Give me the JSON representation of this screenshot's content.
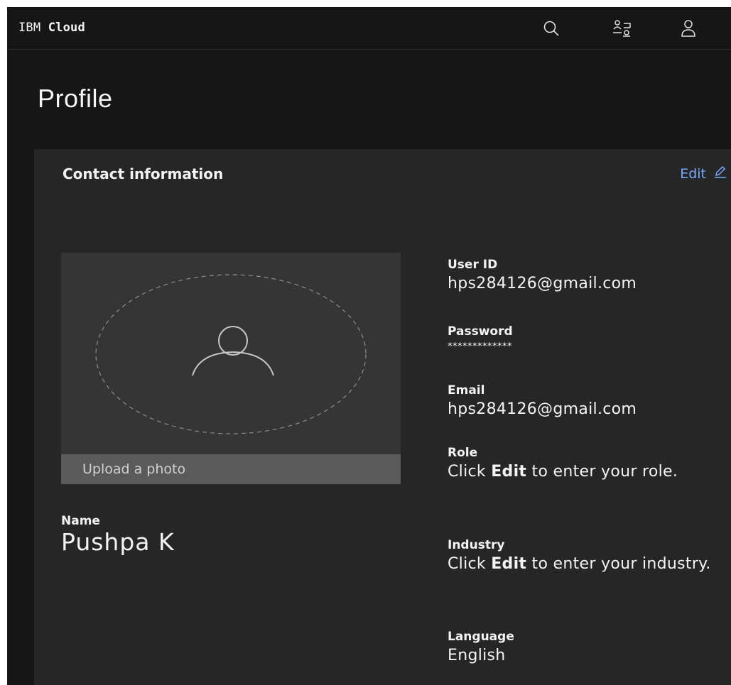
{
  "header": {
    "brand_prefix": "IBM",
    "brand_name": "Cloud",
    "icons": [
      "search-icon",
      "switcher-icon",
      "user-icon"
    ]
  },
  "page": {
    "title": "Profile"
  },
  "card": {
    "title": "Contact information",
    "edit_label": "Edit",
    "edit_icon": "pencil-icon"
  },
  "photo": {
    "upload_label": "Upload a photo"
  },
  "name": {
    "label": "Name",
    "value": "Pushpa K"
  },
  "fields": {
    "user_id": {
      "label": "User ID",
      "value": "hps284126@gmail.com"
    },
    "password": {
      "label": "Password",
      "value": "*************"
    },
    "email": {
      "label": "Email",
      "value": "hps284126@gmail.com"
    },
    "role": {
      "label": "Role",
      "prefix": "Click ",
      "emphasis": "Edit",
      "suffix": " to enter your role."
    },
    "industry": {
      "label": "Industry",
      "prefix": "Click ",
      "emphasis": "Edit",
      "suffix": " to enter your industry."
    },
    "language": {
      "label": "Language",
      "value": "English"
    }
  },
  "colors": {
    "background": "#161616",
    "card": "#262626",
    "link": "#78a9ff",
    "photo_bg": "#353535",
    "upload_bar": "#5a5a5a"
  }
}
